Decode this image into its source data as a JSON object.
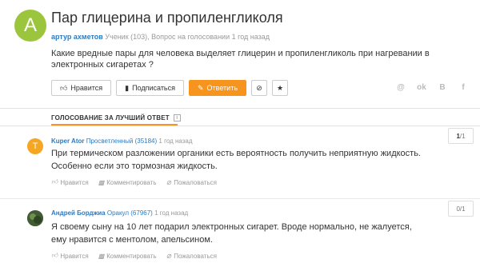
{
  "question": {
    "avatar_letter": "A",
    "title": "Пар глицерина и пропиленгликоля",
    "author": "артур ахметов",
    "author_rank": "Ученик (103), Вопрос на голосовании",
    "time": "1 год назад",
    "body": "Какие вредные пары для человека выделяет глицерин и пропиленгликоль при нагревании в электронных сигаретах ?"
  },
  "actions": {
    "like": "Нравится",
    "subscribe": "Подписаться",
    "answer": "Ответить"
  },
  "social": [
    "@",
    "ok",
    "B",
    "f"
  ],
  "tab": {
    "label": "ГОЛОСОВАНИЕ ЗА ЛУЧШИЙ ОТВЕТ",
    "info": "i"
  },
  "answers": [
    {
      "avatar_letter": "T",
      "avatar_color": "#f5a623",
      "author": "Kuper Ator",
      "rank": "Просветленный (35184)",
      "time": "1 год назад",
      "text": "При термическом разложении органики есть вероятность получить неприятную жидкость. Особенно если это тормозная жидкость.",
      "vote_num": "1",
      "vote_den": "/1"
    },
    {
      "avatar_letter": "",
      "avatar_color": "#4a6b3a",
      "author": "Андрей Борджиа",
      "rank": "Оракул (67967)",
      "time": "1 год назад",
      "text": "Я своему сыну на 10 лет подарил электронных сигарет. Вроде нормально, не жалуется, ему нравится с ментолом, апельсином.",
      "vote_num": "0",
      "vote_den": "/1"
    }
  ],
  "answer_actions": {
    "like": "Нравится",
    "comment": "Комментировать",
    "complain": "Пожаловаться"
  }
}
